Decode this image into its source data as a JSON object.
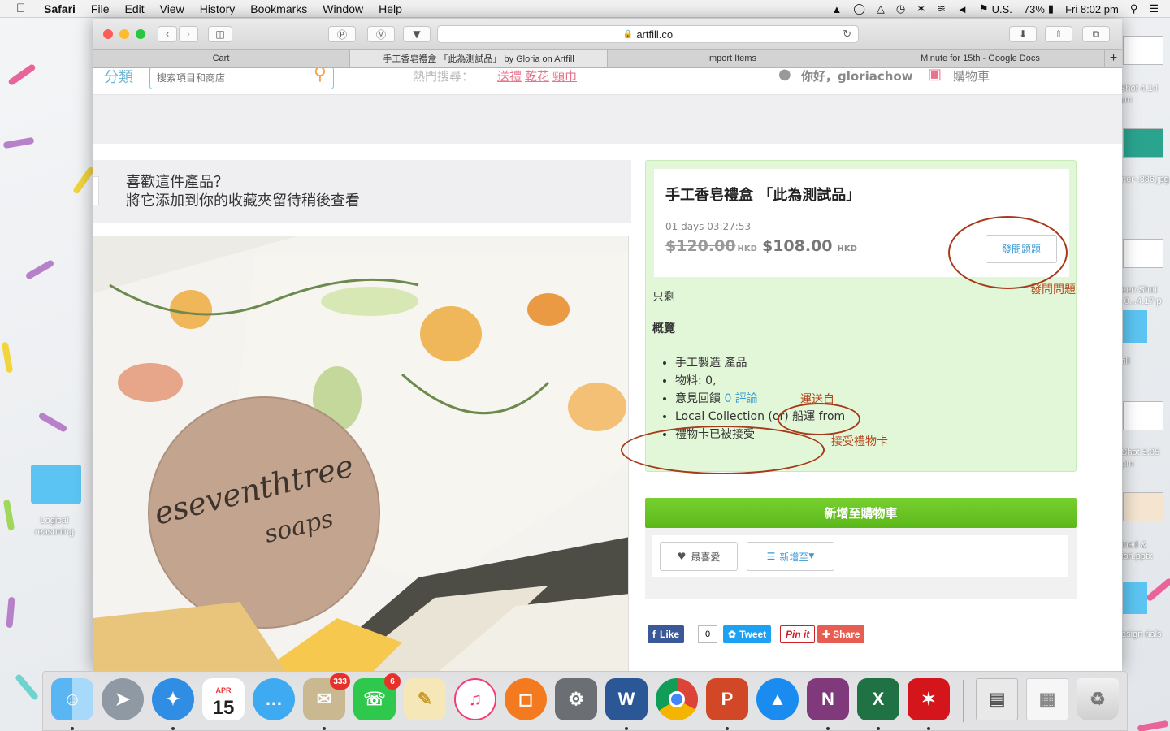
{
  "menubar": {
    "app": "Safari",
    "items": [
      "File",
      "Edit",
      "View",
      "History",
      "Bookmarks",
      "Window",
      "Help"
    ],
    "input_source": "U.S.",
    "battery": "73%",
    "clock": "Fri 8:02 pm"
  },
  "browser": {
    "url": "artfill.co",
    "tabs": [
      "Cart",
      "手工香皂禮盒 「此為測試品」 by Gloria on Artfill",
      "Import Items",
      "Minute for 15th - Google Docs"
    ],
    "new_tab": "+"
  },
  "site": {
    "category": "分類",
    "search_placeholder": "搜索項目和商店",
    "hot_label": "熱門搜尋：",
    "hot_tags": [
      "送禮",
      "乾花",
      "頸巾"
    ],
    "greeting": "你好，gloriachow",
    "cart": "購物車"
  },
  "favorite_prompt": {
    "line1": "喜歡這件產品？",
    "line2": "將它添加到你的收藏夾留待稍後查看"
  },
  "product": {
    "title": "手工香皂禮盒 「此為測試品」",
    "countdown": "01 days 03:27:53",
    "old_price": "$120.00",
    "currency": "HKD",
    "price": "$108.00",
    "ask_button": "發問題題",
    "remaining": "只剩",
    "overview": "概覽"
  },
  "features": {
    "handmade": "手工製造 產品",
    "material": "物料: 0,",
    "feedback_label": "意見回饋",
    "reviews": "0 評論",
    "shipping": "Local Collection (or) 船運 from",
    "giftcard": "禮物卡已被接受"
  },
  "annotations": {
    "ask": "發問問題",
    "ship_from": "運送自",
    "giftcard": "接受禮物卡"
  },
  "actions": {
    "add_to_cart": "新增至購物車",
    "favorite": "最喜愛",
    "add_to": "新增至"
  },
  "social": {
    "like": "Like",
    "like_count": "0",
    "tweet": "Tweet",
    "pin": "Pin it",
    "share": "Share"
  },
  "photo_text": {
    "line1": "eseventhtree",
    "line2": "soaps"
  },
  "desktop_files": [
    "Logical reasoning",
    "Shot 4.14 pm",
    "ner-.886.jpg",
    "een Shot -0...4.17 p",
    "fill",
    "Shot 5.05 pm",
    "ined & ion.pptx",
    "esign rials"
  ],
  "dock": {
    "calendar_month": "APR",
    "calendar_day": "15",
    "mail_badge": "333",
    "facetime_badge": "6",
    "word": "W",
    "powerpoint": "P",
    "onenote": "N",
    "excel": "X"
  }
}
